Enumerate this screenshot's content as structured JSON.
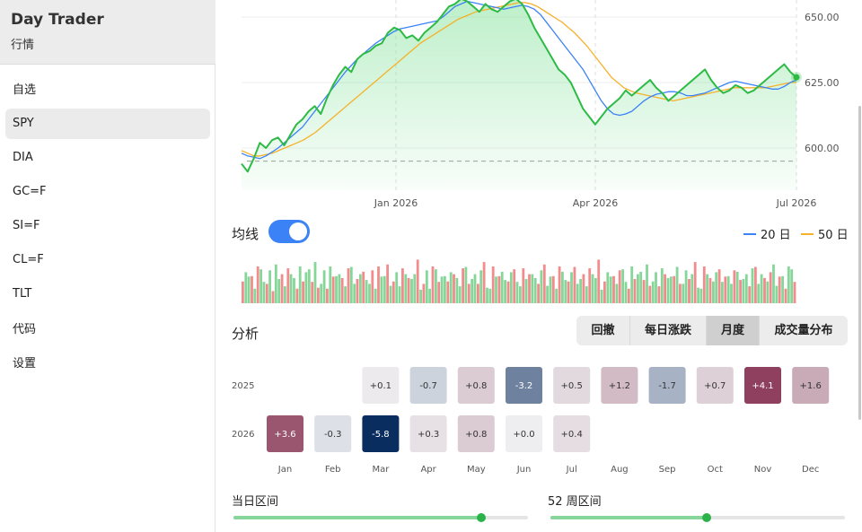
{
  "sidebar": {
    "title": "Day Trader",
    "subtitle": "行情",
    "items": [
      {
        "label": "自选",
        "active": false
      },
      {
        "label": "SPY",
        "active": true
      },
      {
        "label": "DIA",
        "active": false
      },
      {
        "label": "GC=F",
        "active": false
      },
      {
        "label": "SI=F",
        "active": false
      },
      {
        "label": "CL=F",
        "active": false
      },
      {
        "label": "TLT",
        "active": false
      },
      {
        "label": "代码",
        "active": false
      },
      {
        "label": "设置",
        "active": false
      }
    ]
  },
  "chart": {
    "ma_label": "均线",
    "ma_enabled": true,
    "legend_20": "20 日",
    "legend_50": "50 日",
    "color_price": "#2dbb45",
    "color_ma20": "#3b82f6",
    "color_ma50": "#f5b12a",
    "color_up": "#86d69a",
    "color_down": "#f28b8b"
  },
  "analysis": {
    "label": "分析",
    "tabs": [
      {
        "label": "回撤",
        "active": false
      },
      {
        "label": "每日涨跌",
        "active": false
      },
      {
        "label": "月度",
        "active": true
      },
      {
        "label": "成交量分布",
        "active": false
      }
    ]
  },
  "ranges": {
    "day_label": "当日区间",
    "day_position": 0.84,
    "week52_label": "52 周区间",
    "week52_position": 0.53
  },
  "chart_data": [
    {
      "type": "line",
      "x_ticks": [
        "Jan 2026",
        "Apr 2026",
        "Jul 2026"
      ],
      "y_ticks": [
        "650.00",
        "625.00",
        "600.00"
      ],
      "ylim": [
        585,
        656
      ],
      "reference_line": 595,
      "grid": true,
      "series": [
        {
          "name": "20 日",
          "values": [
            598,
            597,
            596.5,
            596,
            597,
            598.5,
            600,
            602,
            604,
            606,
            608,
            611,
            614,
            617,
            620,
            623,
            626,
            629,
            631.5,
            634,
            636,
            638,
            640,
            641.5,
            643,
            644.5,
            645.5,
            646,
            646.5,
            647,
            647.5,
            648,
            648.5,
            650,
            652,
            654,
            655,
            656,
            655.5,
            655,
            654.5,
            654,
            653.5,
            653,
            653.5,
            654,
            654.5,
            654,
            653,
            651,
            648,
            645,
            642,
            639,
            636,
            633,
            630,
            626,
            622,
            618,
            615,
            613,
            612.5,
            613,
            614,
            616,
            618,
            619.5,
            620.5,
            621,
            621.5,
            621.5,
            621,
            620,
            620,
            620.5,
            621,
            622,
            623,
            624,
            625,
            625.5,
            625,
            624.5,
            624,
            623.5,
            623,
            622.5,
            622.5,
            623.5,
            625,
            626
          ]
        },
        {
          "name": "50 日",
          "values": [
            599,
            598,
            597,
            597,
            597.5,
            598,
            599,
            600,
            601,
            602,
            603,
            604.5,
            606,
            608,
            610,
            612,
            614,
            616,
            618,
            620,
            622,
            624,
            626,
            628,
            630,
            632,
            634,
            636,
            638,
            640,
            641.5,
            643,
            644.5,
            646,
            647.5,
            649,
            650,
            651,
            652,
            652.5,
            653,
            653.5,
            654,
            654.5,
            655,
            655.5,
            655.5,
            655,
            654,
            652.5,
            651,
            649.5,
            648,
            646,
            644,
            641.5,
            639,
            636,
            633,
            630,
            627,
            625,
            623,
            622,
            621,
            620.5,
            620,
            619.5,
            619,
            618.5,
            618,
            618.5,
            619,
            619.5,
            620,
            620.5,
            621,
            621.5,
            622,
            622.5,
            623,
            623,
            623,
            623,
            623,
            623,
            623.5,
            624,
            624.5,
            625,
            625
          ]
        },
        {
          "name": "Price",
          "values": [
            594,
            591,
            596,
            602,
            600,
            603,
            604,
            601,
            605,
            609,
            611,
            614,
            616,
            613,
            619,
            624,
            628,
            631,
            629,
            634,
            636,
            637,
            639,
            640,
            644,
            646,
            645,
            642,
            643,
            641,
            644,
            646,
            648,
            651,
            654,
            655,
            657,
            656,
            654,
            652,
            655,
            653,
            652,
            654,
            656,
            657,
            655,
            651,
            646,
            642,
            638,
            634,
            630,
            628,
            625,
            620,
            615,
            612,
            609,
            612,
            615,
            617,
            619,
            622,
            620,
            622,
            624,
            626,
            623,
            621,
            618,
            620,
            622,
            624,
            626,
            628,
            630,
            626,
            623,
            621,
            622,
            624,
            623,
            621,
            622,
            624,
            626,
            628,
            630,
            632,
            629,
            627
          ]
        }
      ]
    },
    {
      "type": "bar",
      "series": [
        {
          "name": "volume",
          "values": [
            0.45,
            0.55,
            0.3,
            0.7,
            0.4,
            0.25,
            0.5,
            0.35,
            0.6,
            0.3,
            0.45,
            0.7,
            0.85,
            0.4,
            0.3,
            0.55,
            0.6,
            0.35,
            0.75,
            0.5,
            0.65,
            0.4,
            0.3,
            0.55,
            0.8,
            0.45,
            0.35,
            0.6,
            0.5,
            0.9,
            0.4,
            0.3,
            0.7,
            0.55,
            0.45,
            0.6,
            0.35,
            0.75,
            0.5,
            0.4,
            0.85,
            0.3,
            0.55,
            0.65,
            0.45,
            0.7,
            0.35,
            0.5,
            0.6,
            0.4,
            0.8,
            0.55,
            0.3,
            0.65,
            0.45,
            0.75,
            0.5,
            0.35,
            0.6,
            0.9,
            0.45,
            0.55,
            0.4,
            0.7,
            0.3,
            0.5,
            0.65,
            0.8,
            0.45,
            0.35,
            0.6,
            0.55,
            0.75,
            0.4,
            0.5,
            0.85,
            0.3,
            0.6,
            0.45,
            0.7,
            0.55,
            0.4,
            0.65,
            0.5,
            0.35,
            0.75,
            0.6,
            0.45,
            0.8,
            0.55,
            0.3,
            0.7
          ]
        }
      ]
    },
    {
      "type": "heatmap",
      "columns": [
        "Jan",
        "Feb",
        "Mar",
        "Apr",
        "May",
        "Jun",
        "Jul",
        "Aug",
        "Sep",
        "Oct",
        "Nov",
        "Dec"
      ],
      "rows": [
        {
          "label": "2025",
          "values": [
            null,
            null,
            "+0.1",
            "-0.7",
            "+0.8",
            "-3.2",
            "+0.5",
            "+1.2",
            "-1.7",
            "+0.7",
            "+4.1",
            "+1.6"
          ]
        },
        {
          "label": "2026",
          "values": [
            "+3.6",
            "-0.3",
            "-5.8",
            "+0.3",
            "+0.8",
            "+0.0",
            "+0.4",
            null,
            null,
            null,
            null,
            null
          ]
        }
      ]
    }
  ]
}
